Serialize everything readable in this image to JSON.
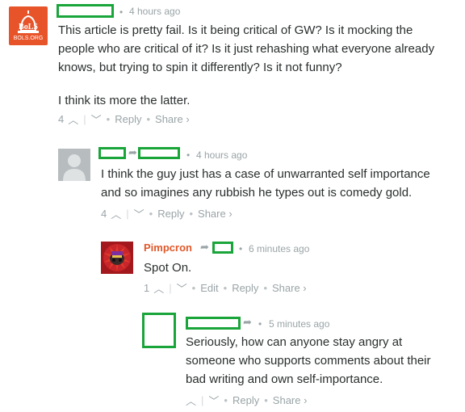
{
  "comments": [
    {
      "avatar_text": "BoLS",
      "avatar_subtext": "BOLS.ORG",
      "time": "4 hours ago",
      "paragraphs": [
        "This article is pretty fail. Is it being critical of GW? Is it mocking the",
        "people who are critical of it? Is it just rehashing what everyone already",
        "knows, but trying to spin it differently? Is it not funny?",
        "I think its more the latter."
      ],
      "votes": "4",
      "reply": "Reply",
      "share": "Share ›"
    },
    {
      "time": "4 hours ago",
      "lines": [
        "I think the guy just has a case of unwarranted self importance",
        "and so imagines any rubbish he types out is comedy gold."
      ],
      "votes": "4",
      "reply": "Reply",
      "share": "Share ›"
    },
    {
      "author": "Pimpcron",
      "time": "6 minutes ago",
      "lines": [
        "Spot On."
      ],
      "votes": "1",
      "edit": "Edit",
      "reply": "Reply",
      "share": "Share ›"
    },
    {
      "time": "5 minutes ago",
      "lines": [
        "Seriously, how can anyone stay angry at",
        "someone who supports comments about their",
        "bad writing and own self-importance."
      ],
      "reply": "Reply",
      "share": "Share ›"
    }
  ],
  "colors": {
    "author_orange": "#e0582a",
    "redaction_green": "#1aa53a",
    "meta_gray": "#9aa4a7"
  },
  "icons": {
    "upvote": "chevron-up-icon",
    "downvote": "chevron-down-icon",
    "reply_to": "reply-arrow-icon"
  }
}
